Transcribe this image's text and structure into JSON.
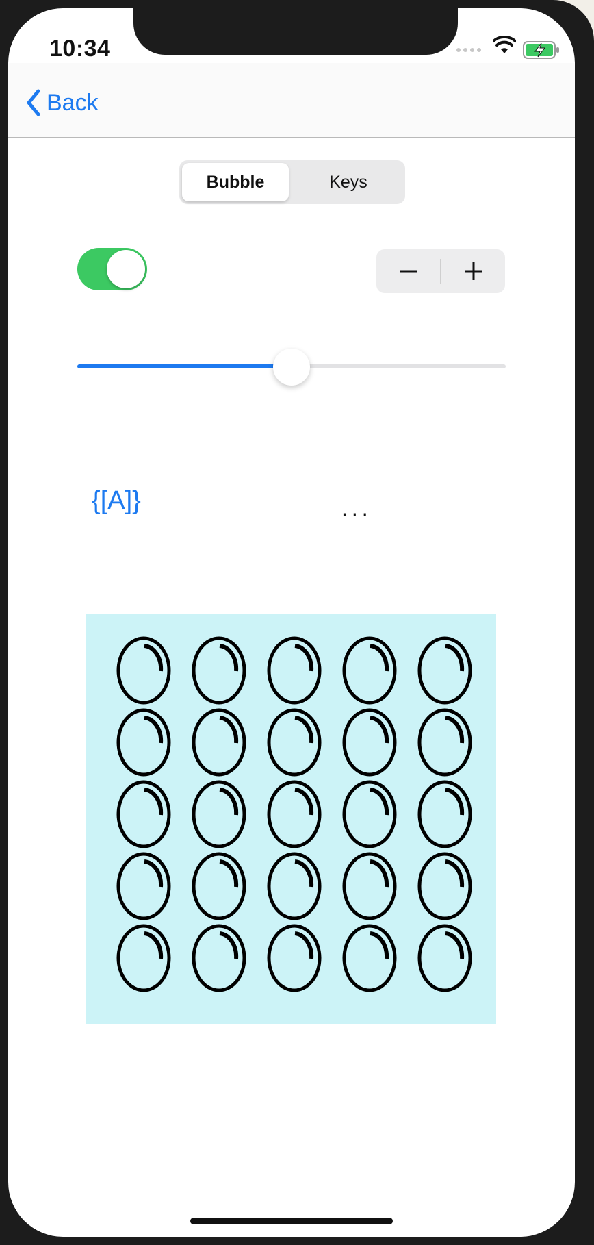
{
  "status_bar": {
    "time": "10:34",
    "wifi_icon": "wifi-icon",
    "battery_icon": "battery-charging-icon"
  },
  "nav": {
    "back_label": "Back"
  },
  "segmented": {
    "items": [
      "Bubble",
      "Keys"
    ],
    "selected": "Bubble"
  },
  "toggle": {
    "on": true
  },
  "stepper": {
    "minus": "−",
    "plus": "+"
  },
  "slider": {
    "value_fraction": 0.5
  },
  "content": {
    "link_text": "{[A]}",
    "ellipsis": "..."
  },
  "bubble_grid": {
    "rows": 5,
    "columns": 5,
    "icon": "bubble-icon"
  },
  "colors": {
    "accent": "#1d7af0",
    "toggle_on": "#3cc962",
    "bubble_bg": "#ccf3f7",
    "battery": "#3cc962"
  }
}
